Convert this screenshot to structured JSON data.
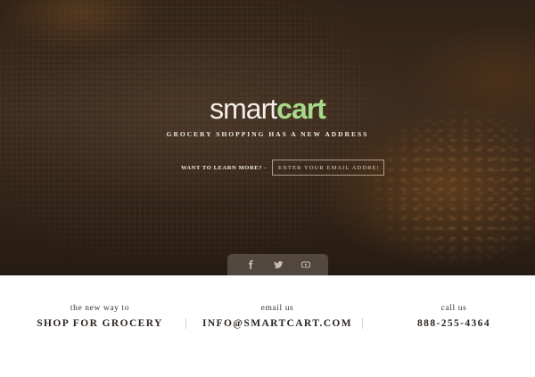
{
  "hero": {
    "logo": {
      "part1": "smart",
      "part2": "cart"
    },
    "tagline": "GROCERY SHOPPING HAS A NEW ADDRESS",
    "signup": {
      "label": "WANT TO LEARN MORE? -",
      "placeholder": "ENTER YOUR EMAIL ADDRESS",
      "value": ""
    },
    "social": [
      {
        "name": "facebook-icon"
      },
      {
        "name": "twitter-icon"
      },
      {
        "name": "youtube-icon"
      }
    ]
  },
  "footer": {
    "columns": [
      {
        "label": "the new way to",
        "value": "SHOP FOR GROCERY"
      },
      {
        "label": "email us",
        "value": "INFO@SMARTCART.COM"
      },
      {
        "label": "call us",
        "value": "888-255-4364"
      }
    ]
  },
  "colors": {
    "brand_green": "#a6d98a",
    "hero_overlay": "#3b2a1c",
    "text_light": "#f1ece4",
    "text_dark": "#2c2622"
  }
}
